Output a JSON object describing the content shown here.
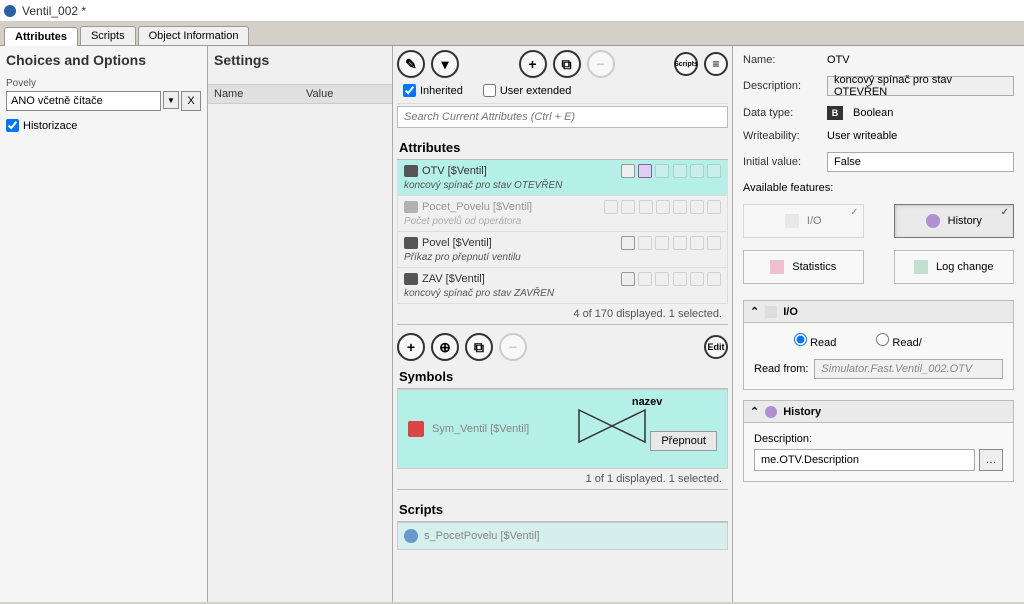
{
  "title": "Ventil_002 *",
  "tabs": [
    "Attributes",
    "Scripts",
    "Object Information"
  ],
  "choices": {
    "header": "Choices and Options",
    "povely_label": "Povely",
    "povely_value": "ANO včetně čítače",
    "historizace": "Historizace"
  },
  "settings": {
    "header": "Settings",
    "col_name": "Name",
    "col_value": "Value"
  },
  "mid": {
    "inherited": "Inherited",
    "user_extended": "User extended",
    "search_placeholder": "Search Current Attributes (Ctrl + E)",
    "attributes_header": "Attributes",
    "attrs": [
      {
        "name": "OTV [$Ventil]",
        "desc": "koncový spínač pro stav OTEVŘEN"
      },
      {
        "name": "Pocet_Povelu [$Ventil]",
        "desc": "Počet povelů od operátora"
      },
      {
        "name": "Povel [$Ventil]",
        "desc": "Příkaz pro přepnutí ventilu"
      },
      {
        "name": "ZAV [$Ventil]",
        "desc": "koncový spínač pro stav ZAVŘEN"
      }
    ],
    "attr_status": "4 of 170 displayed. 1 selected.",
    "edit": "Edit",
    "symbols_header": "Symbols",
    "symbol_label": "Sym_Ventil [$Ventil]",
    "nazev": "nazev",
    "prepnout": "Přepnout",
    "symbol_status": "1 of 1 displayed. 1 selected.",
    "scripts_header": "Scripts",
    "script_label": "s_PocetPovelu [$Ventil]"
  },
  "right": {
    "labels": {
      "name": "Name:",
      "description": "Description:",
      "datatype": "Data type:",
      "writeability": "Writeability:",
      "initial": "Initial value:",
      "available": "Available features:",
      "read_from": "Read from:",
      "desc": "Description:"
    },
    "name": "OTV",
    "description": "koncový spínač pro stav OTEVŘEN",
    "datatype": "Boolean",
    "writeability": "User writeable",
    "initial": "False",
    "features": {
      "io": "I/O",
      "history": "History",
      "statistics": "Statistics",
      "logchange": "Log change"
    },
    "io_panel": "I/O",
    "read": "Read",
    "read_write": "Read/",
    "read_from_value": "Simulator.Fast.Ventil_002.OTV",
    "history_panel": "History",
    "history_desc_value": "me.OTV.Description"
  }
}
